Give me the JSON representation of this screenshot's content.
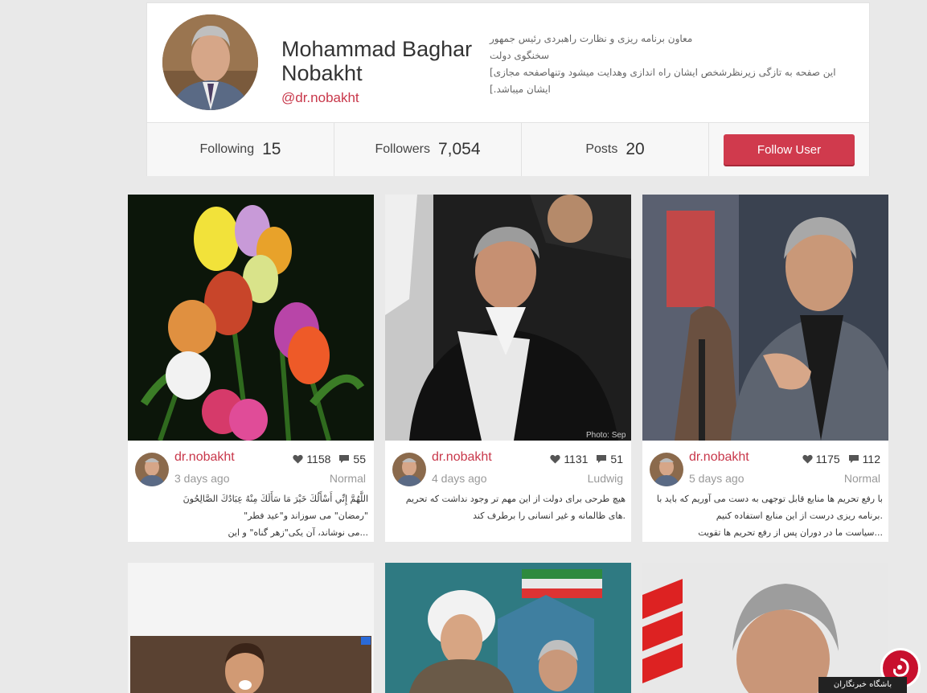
{
  "profile": {
    "name_line1": "Mohammad Baghar",
    "name_line2": "Nobakht",
    "handle": "@dr.nobakht",
    "bio_lines": [
      "معاون برنامه ریزی و نظارت راهبردی رئیس جمهور",
      "سخنگوی دولت",
      "[این صفحه به تازگی زیرنظرشخص ایشان راه اندازی وهدایت میشود وتنهاصفحه مجازی",
      "[.ایشان میباشد"
    ]
  },
  "stats": {
    "following_label": "Following",
    "following_value": "15",
    "followers_label": "Followers",
    "followers_value": "7,054",
    "posts_label": "Posts",
    "posts_value": "20",
    "follow_button": "Follow User"
  },
  "posts": [
    {
      "user": "dr.nobakht",
      "time": "3 days ago",
      "likes": "1158",
      "comments": "55",
      "type": "Normal",
      "caption": [
        "اللَّهُمَّ إِنِّي أَسْأَلُكَ خَيْرَ مَا سَأَلَكَ مِنْهُ عِبَادُكَ الصَّالِحُونَ",
        "\"رمضان\" می سوزاند و\"عید فطر\"",
        "...می نوشاند، آن یکی\"زهر گناه\" و این"
      ]
    },
    {
      "user": "dr.nobakht",
      "time": "4 days ago",
      "likes": "1131",
      "comments": "51",
      "type": "Ludwig",
      "caption": [
        "هیچ طرحی برای دولت از این مهم تر وجود نداشت که تحریم",
        ".های ظالمانه و غیر انسانی را برطرف کند"
      ]
    },
    {
      "user": "dr.nobakht",
      "time": "5 days ago",
      "likes": "1175",
      "comments": "112",
      "type": "Normal",
      "caption": [
        "با رفع تحریم ها منابع قابل توجهی به دست می آوریم که باید با",
        ".برنامه ریزی درست از این منابع استفاده کنیم",
        "...سیاست ما در دوران پس از رفع تحریم ها تقویت"
      ]
    }
  ],
  "watermark": {
    "text": "باشگاه خبرنگاران"
  },
  "colors": {
    "accent": "#c8374a",
    "button": "#d03a4d",
    "page_bg": "#e9e9e9"
  }
}
